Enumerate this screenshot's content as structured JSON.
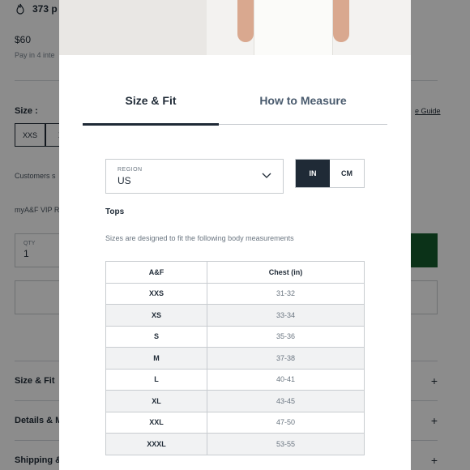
{
  "background": {
    "stock_text": "373 p",
    "price": "$60",
    "pay_in": "Pay in 4 inte",
    "size_label": "Size :",
    "size_guide": "e Guide",
    "size_options": [
      "XXS",
      "X"
    ],
    "customers_text": "Customers s",
    "vip_text": "myA&F VIP R",
    "qty_label": "QTY",
    "qty_value": "1",
    "accordions": [
      {
        "label": "Size & Fit",
        "icon": "plus-icon"
      },
      {
        "label": "Details & M",
        "icon": "plus-icon"
      },
      {
        "label": "Shipping &",
        "icon": "plus-icon"
      }
    ],
    "accent_color": "#145c2c"
  },
  "modal": {
    "tabs": [
      {
        "label": "Size & Fit",
        "active": true
      },
      {
        "label": "How to Measure",
        "active": false
      }
    ],
    "region": {
      "label": "REGION",
      "value": "US",
      "icon": "chevron-down-icon"
    },
    "units": [
      {
        "label": "IN",
        "selected": true
      },
      {
        "label": "CM",
        "selected": false
      }
    ],
    "heading": "Tops",
    "description": "Sizes are designed to fit the following body measurements",
    "table": {
      "headers": [
        "A&F",
        "Chest (in)"
      ],
      "rows": [
        [
          "XXS",
          "31-32"
        ],
        [
          "XS",
          "33-34"
        ],
        [
          "S",
          "35-36"
        ],
        [
          "M",
          "37-38"
        ],
        [
          "L",
          "40-41"
        ],
        [
          "XL",
          "43-45"
        ],
        [
          "XXL",
          "47-50"
        ],
        [
          "XXXL",
          "53-55"
        ]
      ]
    },
    "dark_color": "#1f2a36"
  }
}
